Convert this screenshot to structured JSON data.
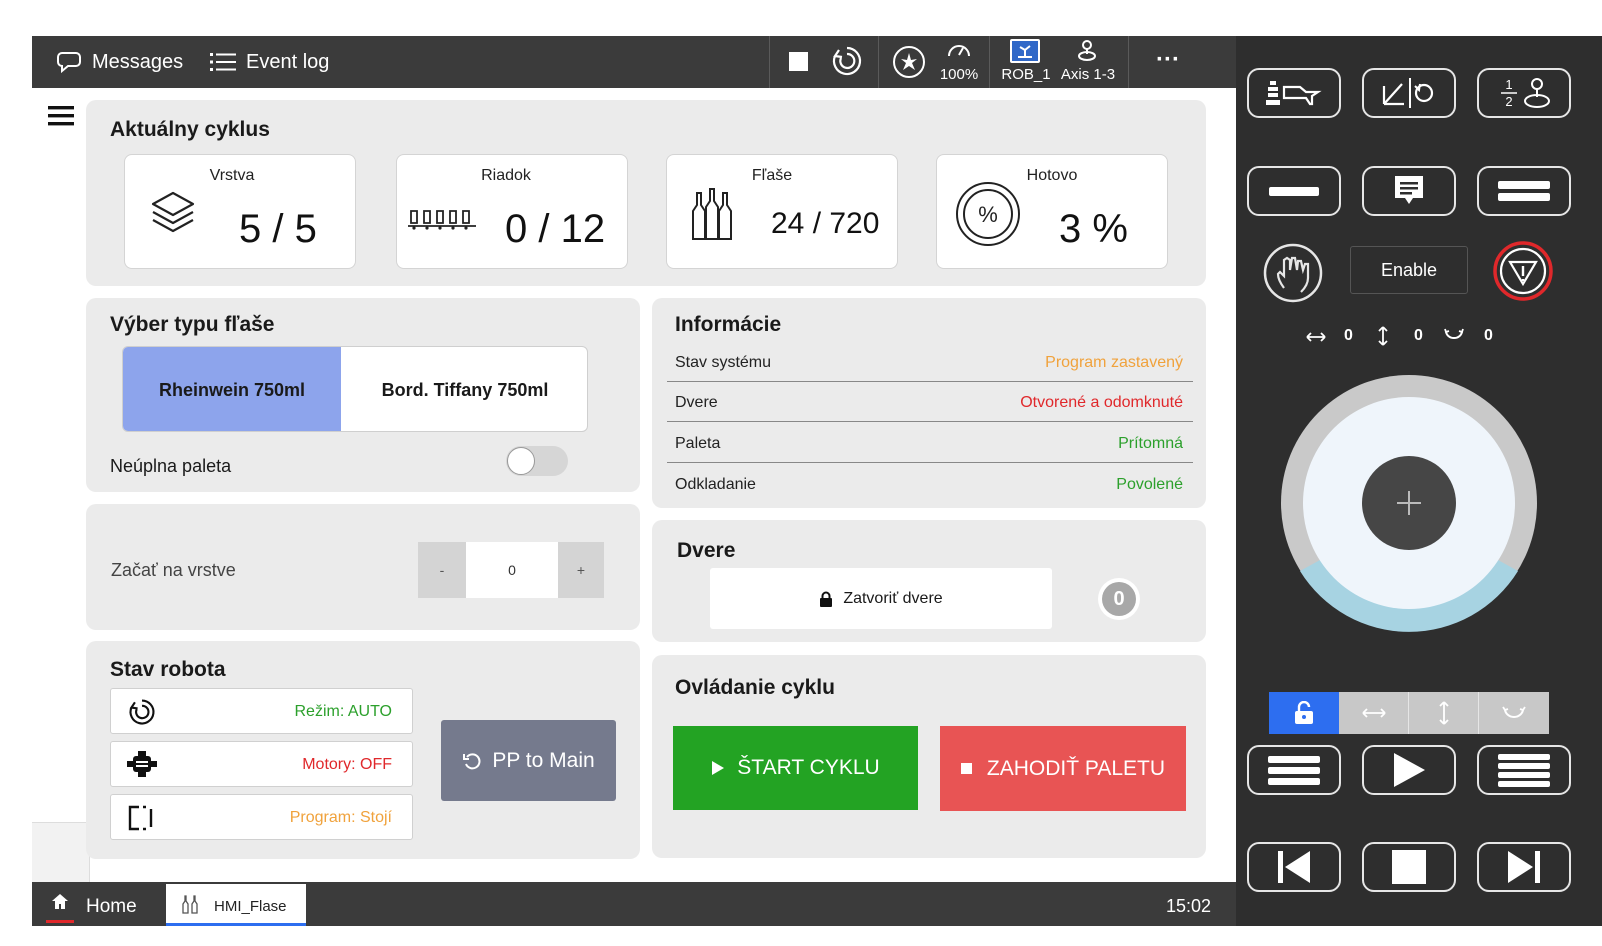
{
  "topbar": {
    "messages_label": "Messages",
    "eventlog_label": "Event log",
    "speed": "100%",
    "robot": "ROB_1",
    "axis": "Axis 1-3",
    "more": "···"
  },
  "cycle": {
    "title": "Aktuálny cyklus",
    "layer": {
      "label": "Vrstva",
      "value": "5 / 5"
    },
    "row": {
      "label": "Riadok",
      "value": "0 / 12"
    },
    "bottles": {
      "label": "Fľaše",
      "value": "24 / 720"
    },
    "done": {
      "label": "Hotovo",
      "value": "3 %",
      "icon_text": "%"
    }
  },
  "bottle_type": {
    "title": "Výber typu fľaše",
    "options": [
      "Rheinwein 750ml",
      "Bord. Tiffany 750ml"
    ],
    "selected_index": 0,
    "incomplete_label": "Neúplna paleta",
    "incomplete_on": false
  },
  "start_layer": {
    "label": "Začať na vrstve",
    "minus": "-",
    "value": "0",
    "plus": "+"
  },
  "robot_state": {
    "title": "Stav robota",
    "mode": "Režim: AUTO",
    "motors": "Motory: OFF",
    "program": "Program: Stojí",
    "pp_label": "PP to Main"
  },
  "info": {
    "title": "Informácie",
    "rows": [
      {
        "key": "Stav systému",
        "value": "Program zastavený",
        "color": "#f0a23c"
      },
      {
        "key": "Dvere",
        "value": "Otvorené a odomknuté",
        "color": "#e0282b"
      },
      {
        "key": "Paleta",
        "value": "Prítomná",
        "color": "#2ca02c"
      },
      {
        "key": "Odkladanie",
        "value": "Povolené",
        "color": "#2ca02c"
      }
    ]
  },
  "doors": {
    "title": "Dvere",
    "close_label": "Zatvoriť dvere",
    "badge": "0"
  },
  "cycle_control": {
    "title": "Ovládanie cyklu",
    "start_label": "ŠTART CYKLU",
    "discard_label": "ZAHODIŤ PALETU"
  },
  "bottombar": {
    "home_label": "Home",
    "tab_label": "HMI_Flase",
    "time": "15:02"
  },
  "flexpendant": {
    "enable_label": "Enable",
    "jog_values": [
      "0",
      "0",
      "0"
    ],
    "fraction_top": "1",
    "fraction_bottom": "2"
  },
  "colors": {
    "selected_option": "#8da4ec",
    "start": "#23a323",
    "discard": "#e85454",
    "pp_button": "#757a8d",
    "mode_green": "#2ca02c",
    "motors_red": "#e0282b",
    "program_orange": "#f0a23c",
    "lock_blue": "#2d6ef0"
  }
}
